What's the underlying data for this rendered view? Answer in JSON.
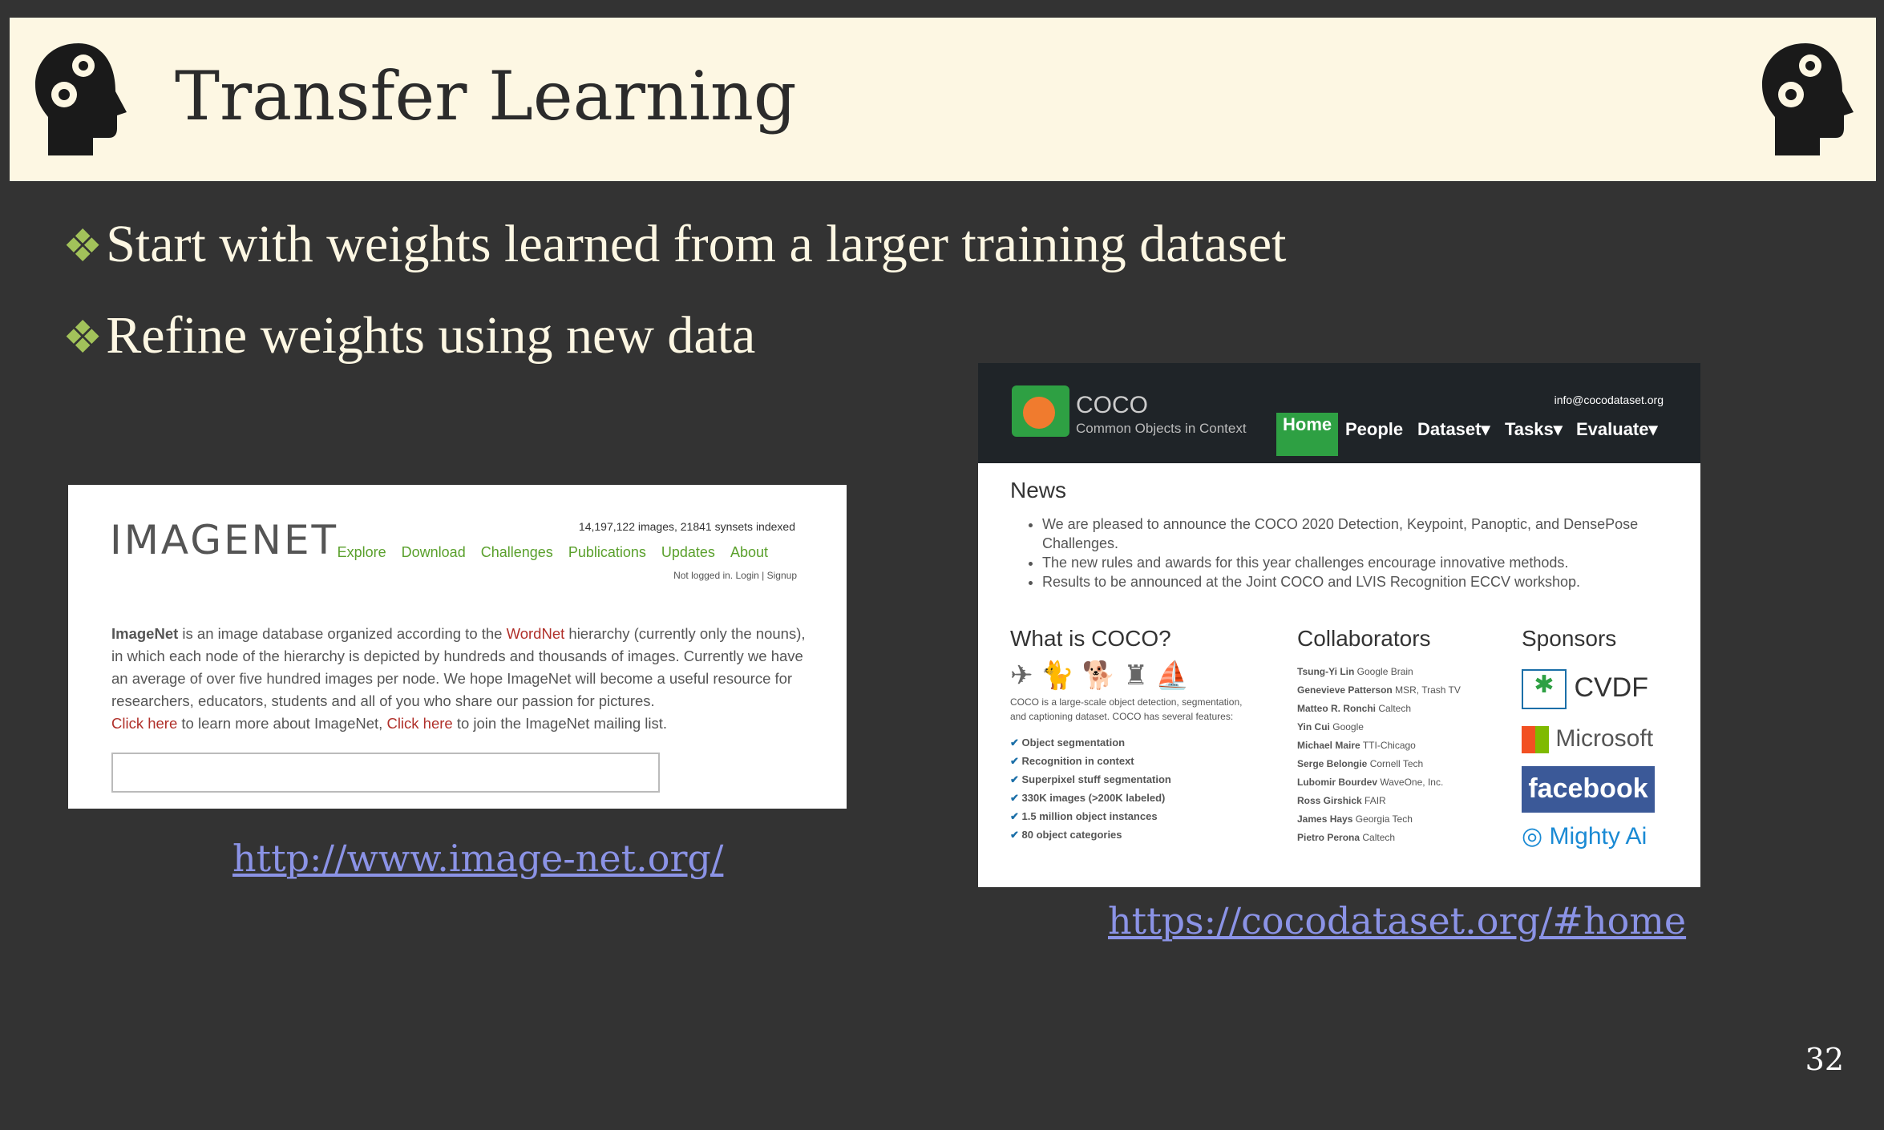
{
  "slide": {
    "title": "Transfer Learning",
    "bullets": [
      "Start with weights learned from a larger training dataset",
      "Refine weights using new data"
    ],
    "page_number": "32"
  },
  "links": {
    "imagenet": "http://www.image-net.org/",
    "coco": "https://cocodataset.org/#home"
  },
  "imagenet": {
    "logo": "IMAGENET",
    "stats": "14,197,122 images, 21841 synsets indexed",
    "nav": [
      "Explore",
      "Download",
      "Challenges",
      "Publications",
      "Updates",
      "About"
    ],
    "login": "Not logged in. Login | Signup",
    "desc_1": "ImageNet",
    "desc_2": " is an image database organized according to the ",
    "desc_3": "WordNet",
    "desc_4": " hierarchy (currently only the nouns), in which each node of the hierarchy is depicted by hundreds and thousands of images. Currently we have an average of over five hundred images per node. We hope ImageNet will become a useful resource for researchers, educators, students and all of you who share our passion for pictures.",
    "click1": "Click here",
    "mid": " to learn more about ImageNet, ",
    "click2": "Click here",
    "end": " to join the ImageNet mailing list."
  },
  "coco": {
    "logo_title": "COCO",
    "logo_sub": "Common Objects in Context",
    "email": "info@cocodataset.org",
    "nav": [
      "Home",
      "People",
      "Dataset",
      "Tasks",
      "Evaluate"
    ],
    "news_title": "News",
    "news": [
      "We are pleased to announce the COCO 2020 Detection, Keypoint, Panoptic, and DensePose Challenges.",
      "The new rules and awards for this year challenges encourage innovative methods.",
      "Results to be announced at the Joint COCO and LVIS Recognition ECCV workshop."
    ],
    "what_title": "What is COCO?",
    "what_desc": "COCO is a large-scale object detection, segmentation, and captioning dataset. COCO has several features:",
    "features": [
      "Object segmentation",
      "Recognition in context",
      "Superpixel stuff segmentation",
      "330K images (>200K labeled)",
      "1.5 million object instances",
      "80 object categories"
    ],
    "collab_title": "Collaborators",
    "collaborators": [
      [
        "Tsung-Yi Lin",
        "Google Brain"
      ],
      [
        "Genevieve Patterson",
        "MSR, Trash TV"
      ],
      [
        "Matteo R. Ronchi",
        "Caltech"
      ],
      [
        "Yin Cui",
        "Google"
      ],
      [
        "Michael Maire",
        "TTI-Chicago"
      ],
      [
        "Serge Belongie",
        "Cornell Tech"
      ],
      [
        "Lubomir Bourdev",
        "WaveOne, Inc."
      ],
      [
        "Ross Girshick",
        "FAIR"
      ],
      [
        "James Hays",
        "Georgia Tech"
      ],
      [
        "Pietro Perona",
        "Caltech"
      ]
    ],
    "sponsors_title": "Sponsors",
    "sponsors": [
      "CVDF",
      "Microsoft",
      "facebook",
      "Mighty Ai"
    ]
  }
}
